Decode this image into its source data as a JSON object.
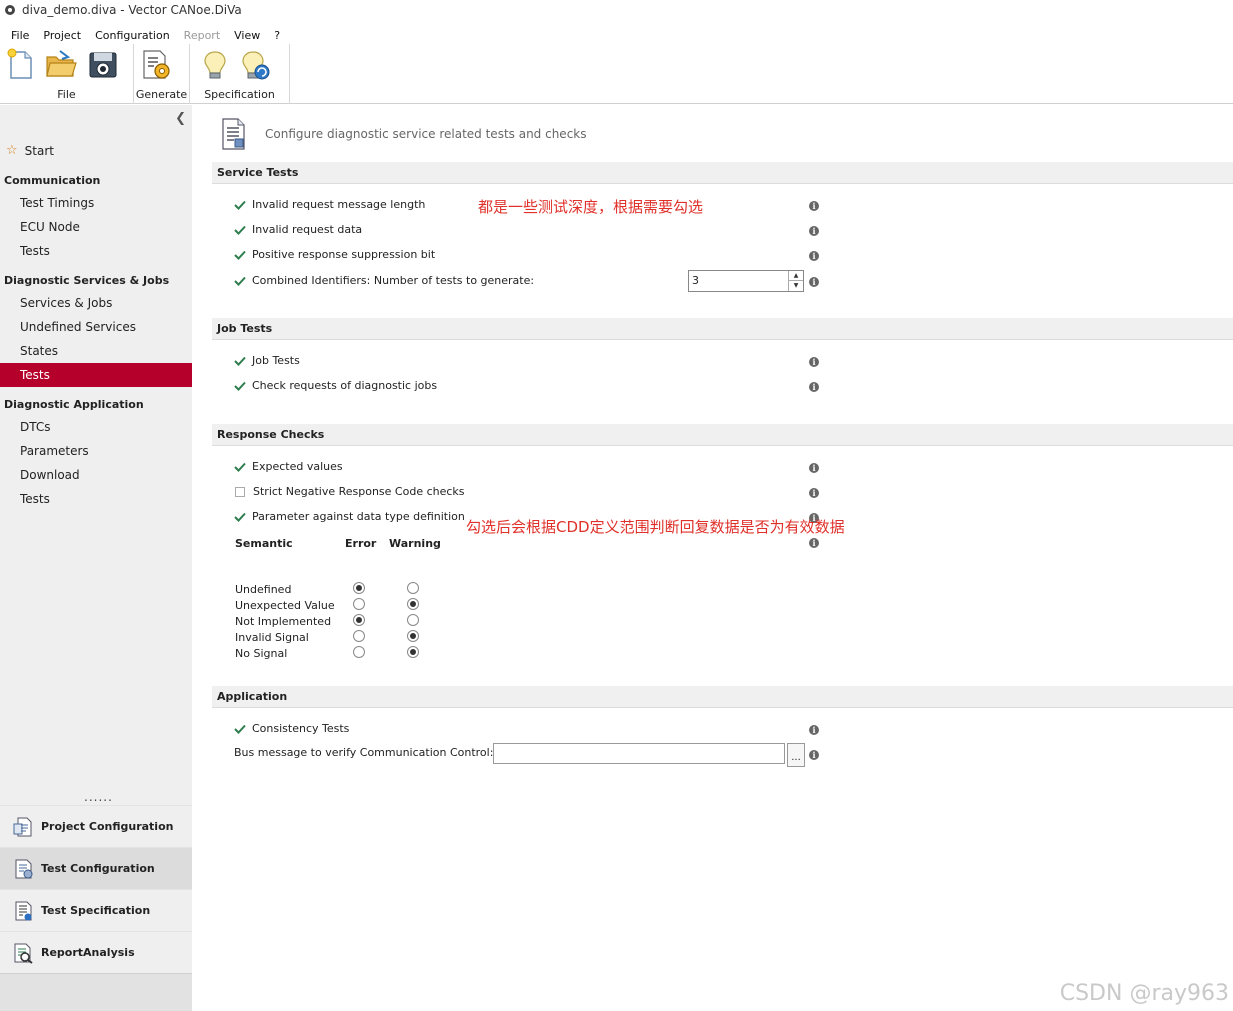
{
  "window": {
    "title": "diva_demo.diva - Vector CANoe.DiVa"
  },
  "menu": [
    {
      "label": "File",
      "enabled": true
    },
    {
      "label": "Project",
      "enabled": true
    },
    {
      "label": "Configuration",
      "enabled": true
    },
    {
      "label": "Report",
      "enabled": false
    },
    {
      "label": "View",
      "enabled": true
    },
    {
      "label": "?",
      "enabled": true
    }
  ],
  "ribbon": {
    "file_label": "File",
    "generate_label": "Generate",
    "specification_label": "Specification"
  },
  "sidebar": {
    "start": "Start",
    "sections": [
      {
        "title": "Communication",
        "items": [
          "Test Timings",
          "ECU Node",
          "Tests"
        ]
      },
      {
        "title": "Diagnostic  Services  &  Jobs",
        "items": [
          "Services & Jobs",
          "Undefined Services",
          "States",
          "Tests"
        ]
      },
      {
        "title": "Diagnostic  Application",
        "items": [
          "DTCs",
          "Parameters",
          "Download",
          "Tests"
        ]
      }
    ],
    "active_item": "Tests",
    "dots": "......",
    "bottom_nav": [
      {
        "label": "Project Configuration",
        "icon": "project-config-icon"
      },
      {
        "label": "Test Configuration",
        "icon": "test-config-icon"
      },
      {
        "label": "Test Specification",
        "icon": "test-spec-icon"
      },
      {
        "label": "ReportAnalysis",
        "icon": "report-analysis-icon"
      }
    ]
  },
  "main": {
    "header": "Configure diagnostic service related tests and checks",
    "service_tests": {
      "title": "Service Tests",
      "items": [
        {
          "label": "Invalid request message length",
          "checked": true
        },
        {
          "label": "Invalid request data",
          "checked": true
        },
        {
          "label": "Positive response suppression bit",
          "checked": true
        },
        {
          "label": "Combined Identifiers: Number of tests to generate:",
          "checked": true
        }
      ],
      "combined_value": "3",
      "note": "都是一些测试深度，根据需要勾选"
    },
    "job_tests": {
      "title": "Job Tests",
      "items": [
        {
          "label": "Job Tests",
          "checked": true
        },
        {
          "label": "Check requests of diagnostic jobs",
          "checked": true
        }
      ]
    },
    "response_checks": {
      "title": "Response Checks",
      "items": [
        {
          "label": "Expected values",
          "checked": true
        },
        {
          "label": "Strict Negative Response Code checks",
          "checked": false
        },
        {
          "label": "Parameter against data type definition",
          "checked": true
        }
      ],
      "note": "勾选后会根据CDD定义范围判断回复数据是否为有效数据",
      "table_headers": [
        "Semantic",
        "Error",
        "Warning"
      ],
      "rows": [
        {
          "label": "Undefined",
          "selected": "Error"
        },
        {
          "label": "Unexpected Value",
          "selected": "Warning"
        },
        {
          "label": "Not Implemented",
          "selected": "Error"
        },
        {
          "label": "Invalid Signal",
          "selected": "Warning"
        },
        {
          "label": "No Signal",
          "selected": "Warning"
        }
      ]
    },
    "application": {
      "title": "Application",
      "consistency": {
        "label": "Consistency Tests",
        "checked": true
      },
      "bus_label": "Bus message to verify Communication Control:",
      "bus_value": "",
      "browse_label": "..."
    }
  },
  "watermark": "CSDN @ray963",
  "colors": {
    "accent": "#b5002b",
    "note": "#e0302a",
    "check": "#2e7d4f"
  }
}
